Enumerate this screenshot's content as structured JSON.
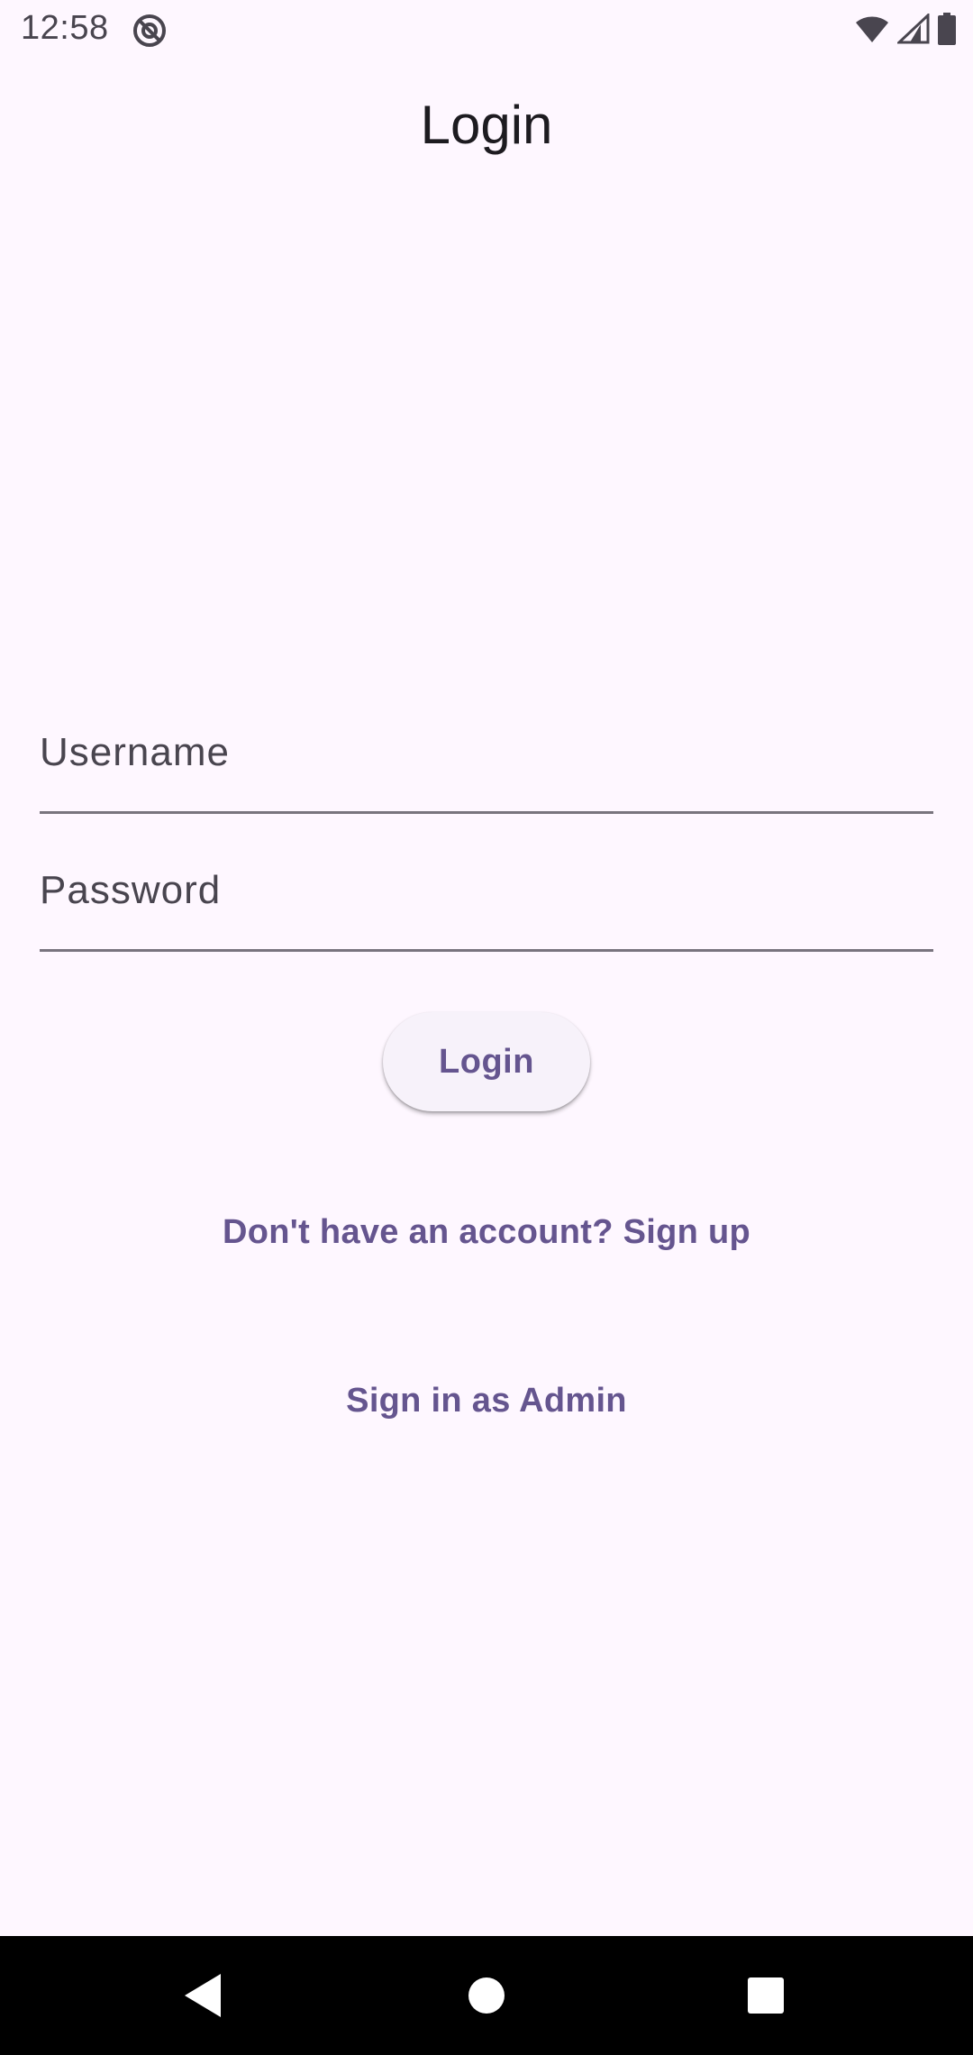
{
  "status_bar": {
    "time": "12:58"
  },
  "app_bar": {
    "title": "Login"
  },
  "form": {
    "username_placeholder": "Username",
    "password_placeholder": "Password",
    "login_label": "Login",
    "signup_link": "Don't have an account? Sign up",
    "admin_link": "Sign in as Admin"
  },
  "colors": {
    "background": "#FEF7FF",
    "accent": "#65558F",
    "button_surface": "#F7F2FA",
    "underline": "#79747E"
  }
}
